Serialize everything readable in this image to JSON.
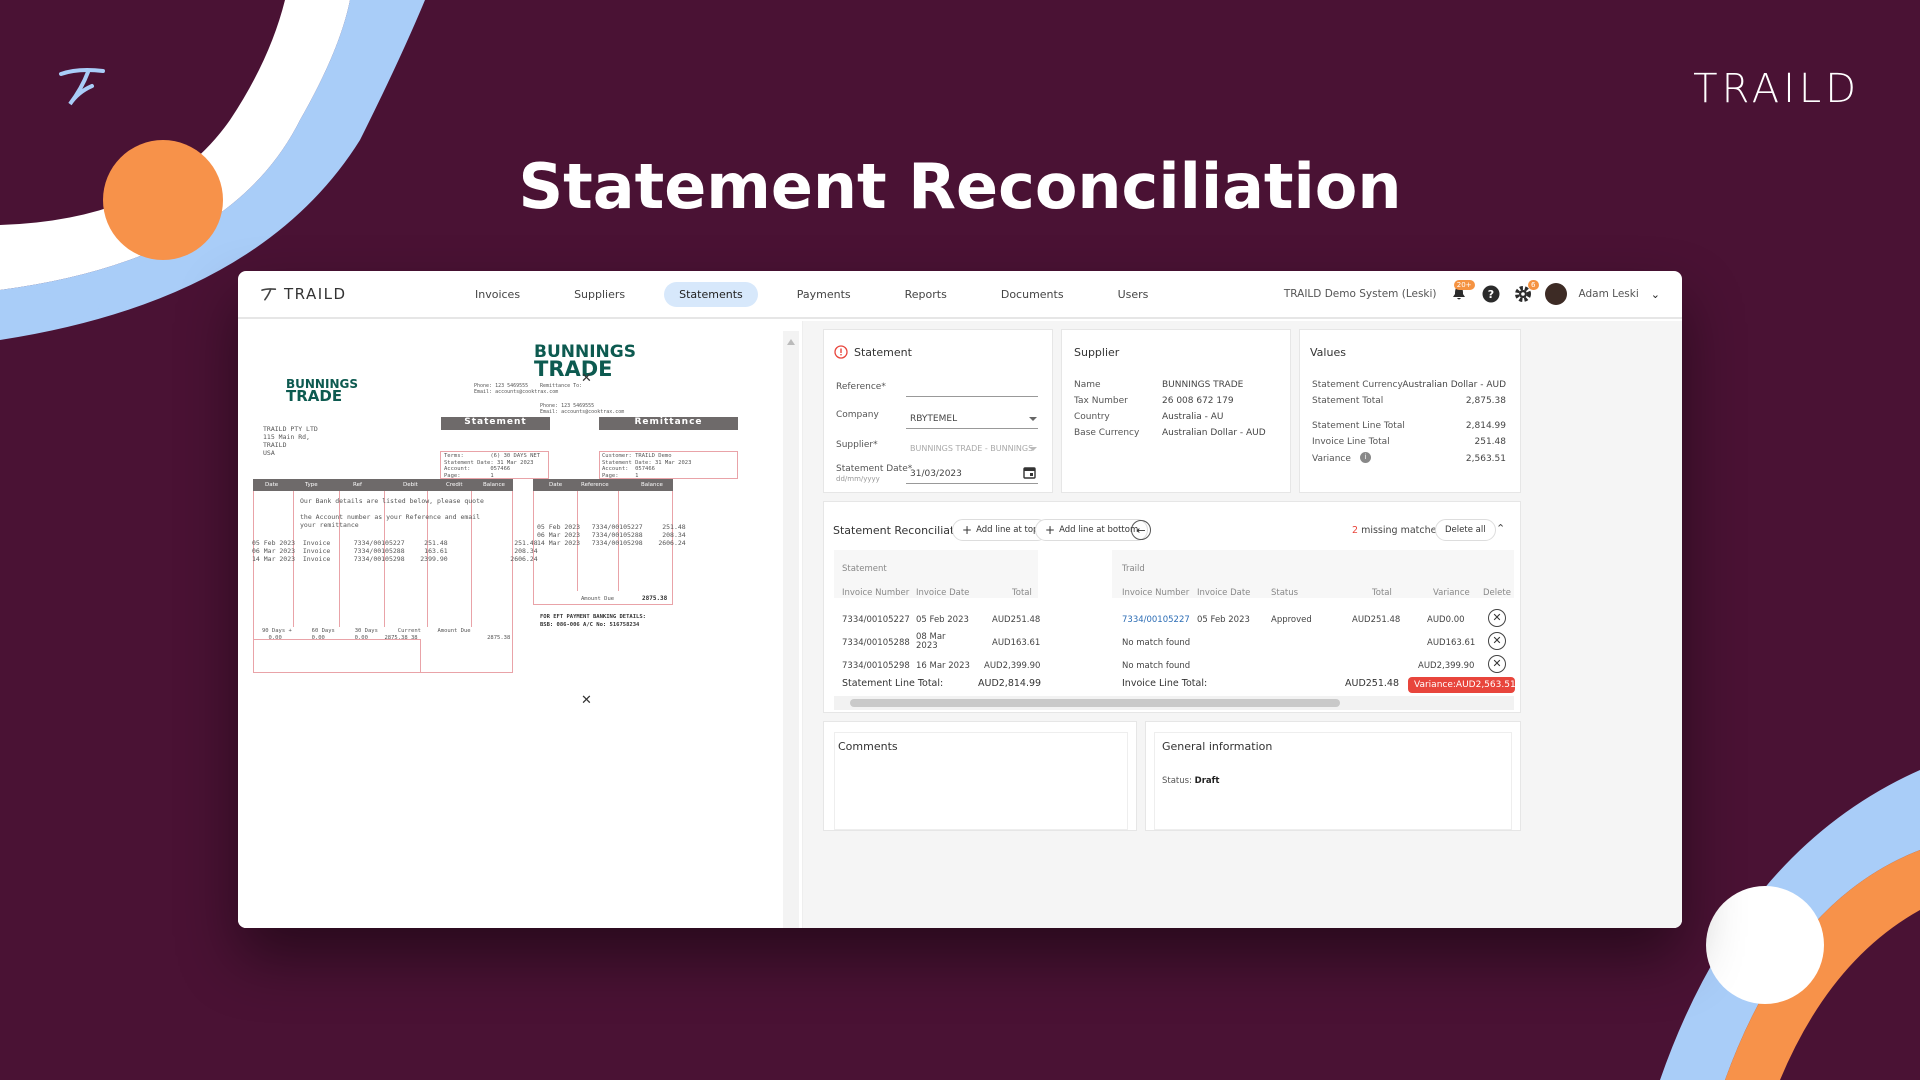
{
  "slide": {
    "title": "Statement Reconciliation",
    "brand": "TRAILD"
  },
  "colors": {
    "background": "#4a1234",
    "orange": "#f7924a",
    "blue": "#a9cdf8",
    "accent": "#e8453c",
    "nav_active": "#d7e8fb"
  },
  "topbar": {
    "logo": "TRAILD",
    "nav": [
      "Invoices",
      "Suppliers",
      "Statements",
      "Payments",
      "Reports",
      "Documents",
      "Users"
    ],
    "active_nav": "Statements",
    "system": "TRAILD Demo System (Leski)",
    "notifications_count": "20+",
    "settings_badge": "6",
    "user": "Adam Leski",
    "icons": [
      "bell-icon",
      "help-icon",
      "gear-icon",
      "avatar",
      "chevron-down-icon"
    ]
  },
  "document": {
    "logo_line1": "BUNNINGS",
    "logo_line2": "TRADE",
    "phone_email": "Phone: 123 5469555\nEmail: accounts@cooktrax.com",
    "phone_email2": "Phone: 123 5469555\nEmail: accounts@cooktrax.com",
    "remittance_to": "Remittance To:",
    "statement_label": "Statement",
    "remittance_label": "Remittance",
    "address": "TRAILD PTY LTD\n115 Main Rd,\nTRAILD\nUSA",
    "terms": "Terms:        (6) 30 DAYS NET\nStatement Date: 31 Mar 2023\nAccount:      057466\nPage:         1",
    "remit_info": "Customer: TRAILD Demo\nStatement Date: 31 Mar 2023\nAccount:  057466\nPage:     1",
    "col_heads": [
      "Date",
      "Type",
      "Ref",
      "Debit",
      "Credit",
      "Balance"
    ],
    "remit_heads": [
      "Date",
      "Reference",
      "Balance"
    ],
    "notes": "Our Bank details are listed below, please quote\n\nthe Account number as your Reference and email\nyour remittance",
    "rows": "05 Feb 2023  Invoice      7334/00105227     251.48                 251.48\n06 Mar 2023  Invoice      7334/00105288     163.61                 208.34\n14 Mar 2023  Invoice      7334/00105298    2399.90                2606.24",
    "remit_rows": "05 Feb 2023   7334/00105227     251.48\n06 Mar 2023   7334/00105288     208.34\n14 Mar 2023   7334/00105298    2606.24",
    "aging_labels": "90 Days +      60 Days      30 Days      Current     Amount Due",
    "aging_values": "     0.00         0.00         0.00     2875.38 38                     2875.38",
    "amount_due_label": "Amount Due",
    "amount_due": "2875.38",
    "bank": "FOR EFT PAYMENT BANKING DETAILS:\nBSB: 086-006 A/C No: 516758234"
  },
  "statement_card": {
    "title": "Statement",
    "reference_label": "Reference*",
    "reference_value": "",
    "company_label": "Company",
    "company_value": "RBYTEMEL",
    "supplier_label": "Supplier*",
    "supplier_value": "BUNNINGS TRADE - BUNNINGS",
    "date_label": "Statement Date*",
    "date_hint": "dd/mm/yyyy",
    "date_value": "31/03/2023"
  },
  "supplier_card": {
    "title": "Supplier",
    "rows": [
      {
        "k": "Name",
        "v": "BUNNINGS TRADE"
      },
      {
        "k": "Tax Number",
        "v": "26 008 672 179"
      },
      {
        "k": "Country",
        "v": "Australia - AU"
      },
      {
        "k": "Base Currency",
        "v": "Australian Dollar - AUD"
      }
    ]
  },
  "values_card": {
    "title": "Values",
    "rows": [
      {
        "k": "Statement Currency",
        "v": "Australian Dollar - AUD"
      },
      {
        "k": "Statement Total",
        "v": "2,875.38"
      },
      {
        "k": "Statement Line Total",
        "v": "2,814.99"
      },
      {
        "k": "Invoice Line Total",
        "v": "251.48"
      },
      {
        "k": "Variance",
        "v": "2,563.51"
      }
    ]
  },
  "reconciliation": {
    "title": "Statement Reconciliation",
    "add_top": "Add line at top",
    "add_bottom": "Add line at bottom",
    "missing_count": "2",
    "missing_text": "missing matches",
    "delete_all": "Delete all",
    "statement_section": "Statement",
    "traild_section": "Traild",
    "statement_headers": [
      "Invoice Number",
      "Invoice Date",
      "Total"
    ],
    "traild_headers": [
      "Invoice Number",
      "Invoice Date",
      "Status",
      "Total",
      "Variance",
      "Delete"
    ],
    "rows": [
      {
        "s_num": "7334/00105227",
        "s_date": "05 Feb 2023",
        "s_total": "AUD251.48",
        "t_num": "7334/00105227",
        "t_date": "05 Feb 2023",
        "t_status": "Approved",
        "t_total": "AUD251.48",
        "t_var": "AUD0.00"
      },
      {
        "s_num": "7334/00105288",
        "s_date": "08 Mar 2023",
        "s_total": "AUD163.61",
        "t_num": "No match found",
        "t_date": "",
        "t_status": "",
        "t_total": "",
        "t_var": "AUD163.61"
      },
      {
        "s_num": "7334/00105298",
        "s_date": "16 Mar 2023",
        "s_total": "AUD2,399.90",
        "t_num": "No match found",
        "t_date": "",
        "t_status": "",
        "t_total": "",
        "t_var": "AUD2,399.90"
      }
    ],
    "statement_total_label": "Statement Line Total:",
    "statement_total": "AUD2,814.99",
    "invoice_total_label": "Invoice Line Total:",
    "invoice_total": "AUD251.48",
    "variance_label": "Variance:",
    "variance_total": "AUD2,563.51"
  },
  "comments": {
    "title": "Comments"
  },
  "general": {
    "title": "General information",
    "status_label": "Status:",
    "status_value": "Draft"
  }
}
